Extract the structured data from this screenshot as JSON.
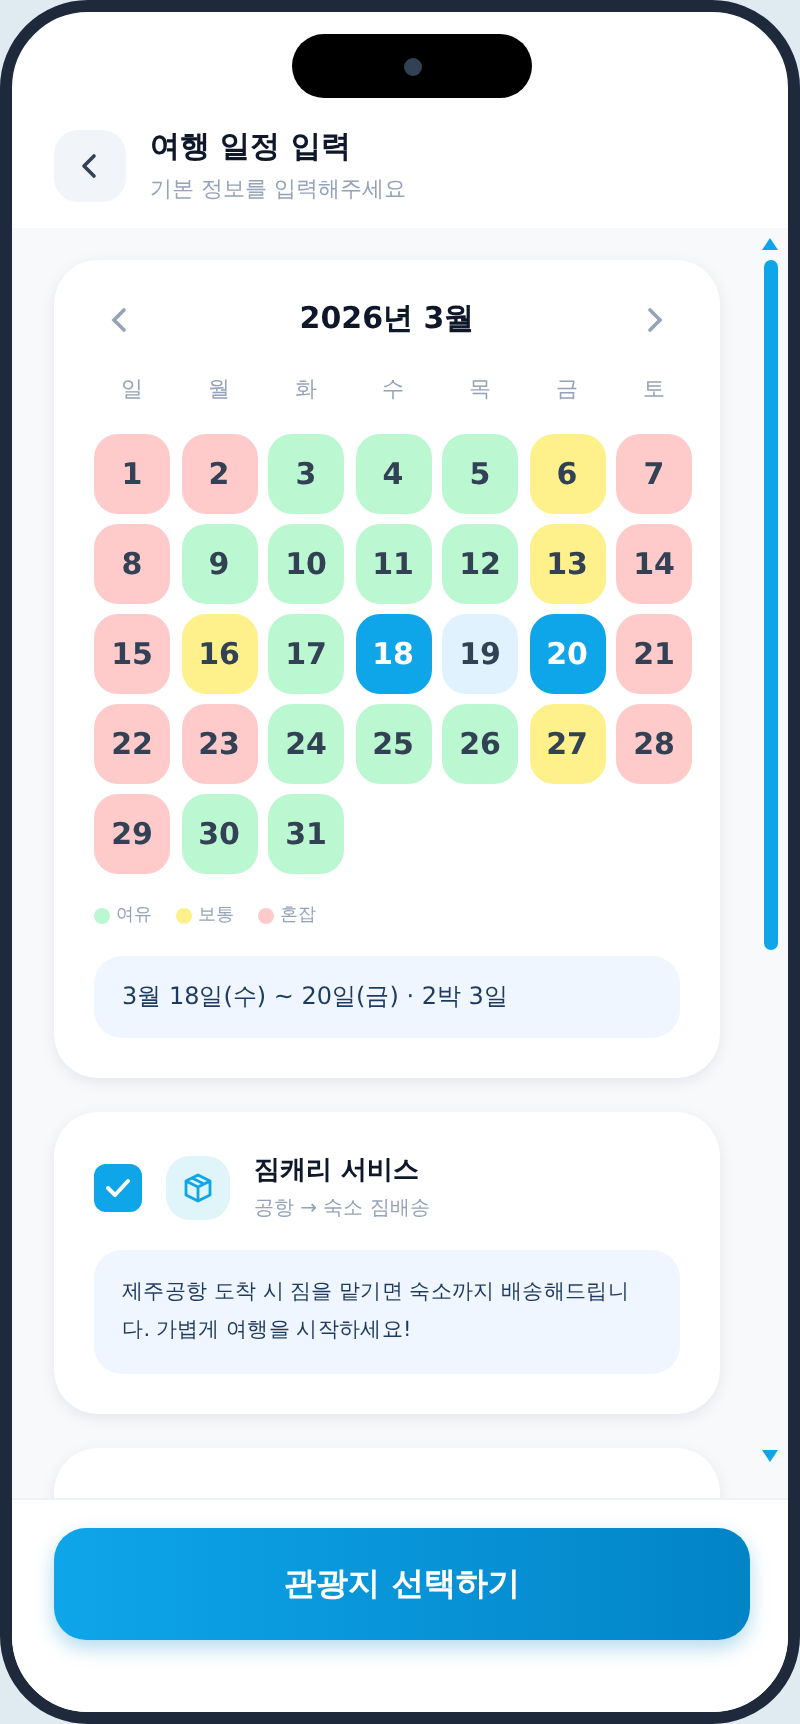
{
  "header": {
    "title": "여행 일정 입력",
    "subtitle": "기본 정보를 입력해주세요"
  },
  "calendar": {
    "month": "2026년 3월",
    "weekdays": [
      "일",
      "월",
      "화",
      "수",
      "목",
      "금",
      "토"
    ],
    "days": [
      {
        "label": "1",
        "color": "#fecaca",
        "selected": false
      },
      {
        "label": "2",
        "color": "#fecaca",
        "selected": false
      },
      {
        "label": "3",
        "color": "#bbf7d0",
        "selected": false
      },
      {
        "label": "4",
        "color": "#bbf7d0",
        "selected": false
      },
      {
        "label": "5",
        "color": "#bbf7d0",
        "selected": false
      },
      {
        "label": "6",
        "color": "#fef08a",
        "selected": false
      },
      {
        "label": "7",
        "color": "#fecaca",
        "selected": false
      },
      {
        "label": "8",
        "color": "#fecaca",
        "selected": false
      },
      {
        "label": "9",
        "color": "#bbf7d0",
        "selected": false
      },
      {
        "label": "10",
        "color": "#bbf7d0",
        "selected": false
      },
      {
        "label": "11",
        "color": "#bbf7d0",
        "selected": false
      },
      {
        "label": "12",
        "color": "#bbf7d0",
        "selected": false
      },
      {
        "label": "13",
        "color": "#fef08a",
        "selected": false
      },
      {
        "label": "14",
        "color": "#fecaca",
        "selected": false
      },
      {
        "label": "15",
        "color": "#fecaca",
        "selected": false
      },
      {
        "label": "16",
        "color": "#fef08a",
        "selected": false
      },
      {
        "label": "17",
        "color": "#bbf7d0",
        "selected": false
      },
      {
        "label": "18",
        "selected": true
      },
      {
        "label": "19",
        "color": "#e0f2fe",
        "selected": false
      },
      {
        "label": "20",
        "selected": true
      },
      {
        "label": "21",
        "color": "#fecaca",
        "selected": false
      },
      {
        "label": "22",
        "color": "#fecaca",
        "selected": false
      },
      {
        "label": "23",
        "color": "#fecaca",
        "selected": false
      },
      {
        "label": "24",
        "color": "#bbf7d0",
        "selected": false
      },
      {
        "label": "25",
        "color": "#bbf7d0",
        "selected": false
      },
      {
        "label": "26",
        "color": "#bbf7d0",
        "selected": false
      },
      {
        "label": "27",
        "color": "#fef08a",
        "selected": false
      },
      {
        "label": "28",
        "color": "#fecaca",
        "selected": false
      },
      {
        "label": "29",
        "color": "#fecaca",
        "selected": false
      },
      {
        "label": "30",
        "color": "#bbf7d0",
        "selected": false
      },
      {
        "label": "31",
        "color": "#bbf7d0",
        "selected": false
      }
    ],
    "legend": [
      {
        "label": "여유",
        "color": "#bbf7d0"
      },
      {
        "label": "보통",
        "color": "#fef08a"
      },
      {
        "label": "혼잡",
        "color": "#fecaca"
      }
    ],
    "summary": "3월 18일(수) ~ 20일(금) · 2박 3일"
  },
  "service": {
    "checked": true,
    "title": "짐캐리 서비스",
    "subtitle": "공항 → 숙소 짐배송",
    "description": "제주공항 도착 시 짐을 맡기면 숙소까지 배송해드립니다. 가볍게 여행을 시작하세요!"
  },
  "primary_button": "관광지 선택하기"
}
